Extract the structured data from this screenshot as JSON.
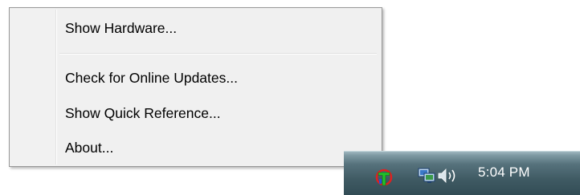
{
  "context_menu": {
    "items": [
      {
        "label": "Show Hardware..."
      },
      {
        "label": "Check for Online Updates..."
      },
      {
        "label": "Show Quick Reference..."
      },
      {
        "label": "About..."
      }
    ]
  },
  "taskbar": {
    "tray_icons": [
      "trend-micro-icon",
      "network-icon",
      "volume-icon"
    ],
    "clock": "5:04 PM"
  },
  "colors": {
    "menu_background": "#f0f0f0",
    "menu_border": "#979797",
    "taskbar": "#3f5a63",
    "clock_text": "#ffffff"
  }
}
